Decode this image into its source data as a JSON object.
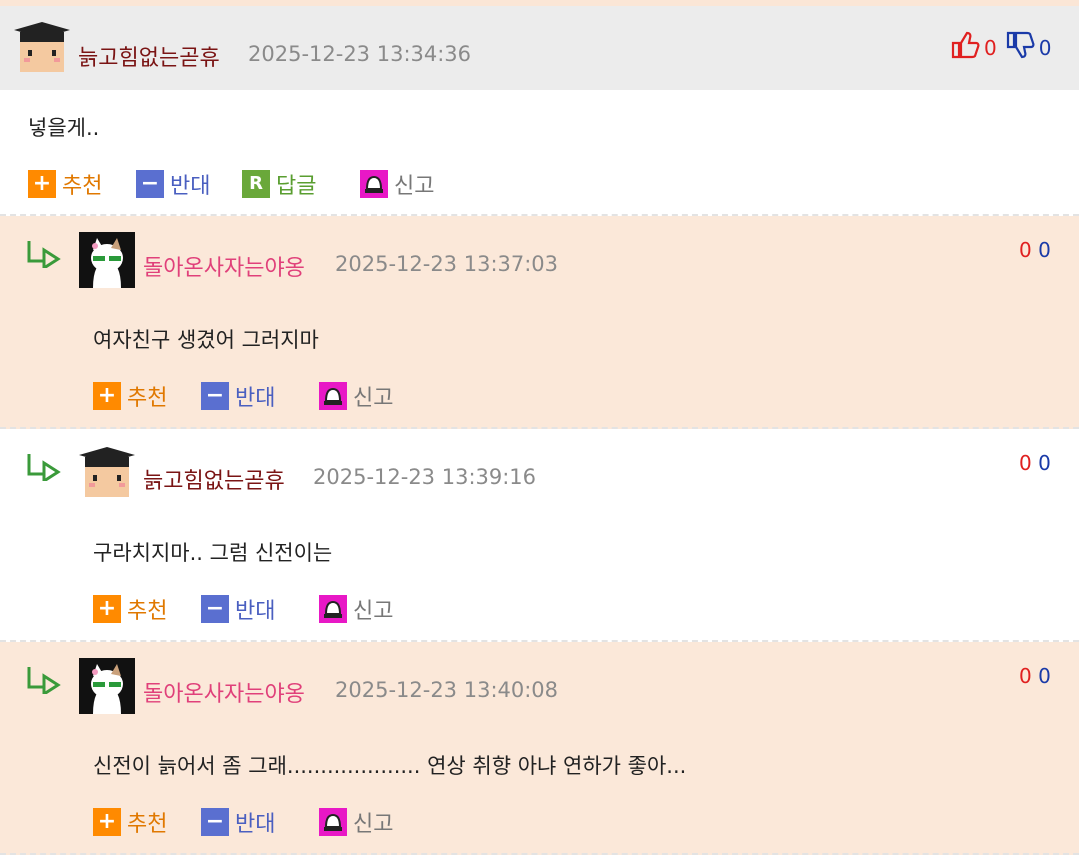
{
  "colors": {
    "accent_up": "#e02020",
    "accent_down": "#1a3aa8",
    "recommend": "#ff8a00",
    "oppose": "#5a6fd0",
    "reply": "#6aa83a",
    "report": "#e818c6",
    "reply_bg": "#fbe8d9"
  },
  "main": {
    "author": "늙고힘없는곧휴",
    "date": "2025-12-23 13:34:36",
    "up_count": "0",
    "down_count": "0",
    "text": "넣을게..",
    "actions": {
      "recommend": "추천",
      "oppose": "반대",
      "reply": "답글",
      "report": "신고"
    },
    "icons": {
      "recommend": "plus-icon",
      "oppose": "minus-icon",
      "reply": "reply-r-icon",
      "report": "siren-icon",
      "up": "thumbs-up-icon",
      "down": "thumbs-down-icon"
    }
  },
  "replies": [
    {
      "author": "돌아온사자는야옹",
      "date": "2025-12-23 13:37:03",
      "up": "0",
      "down": "0",
      "text": "여자친구 생겼어 그러지마",
      "recommend": "추천",
      "oppose": "반대",
      "report": "신고"
    },
    {
      "author": "늙고힘없는곧휴",
      "date": "2025-12-23 13:39:16",
      "up": "0",
      "down": "0",
      "text": "구라치지마.. 그럼 신전이는",
      "recommend": "추천",
      "oppose": "반대",
      "report": "신고"
    },
    {
      "author": "돌아온사자는야옹",
      "date": "2025-12-23 13:40:08",
      "up": "0",
      "down": "0",
      "text": "신전이 늙어서 좀 그래.................... 연상 취향 아냐 연하가 좋아...",
      "recommend": "추천",
      "oppose": "반대",
      "report": "신고"
    }
  ]
}
